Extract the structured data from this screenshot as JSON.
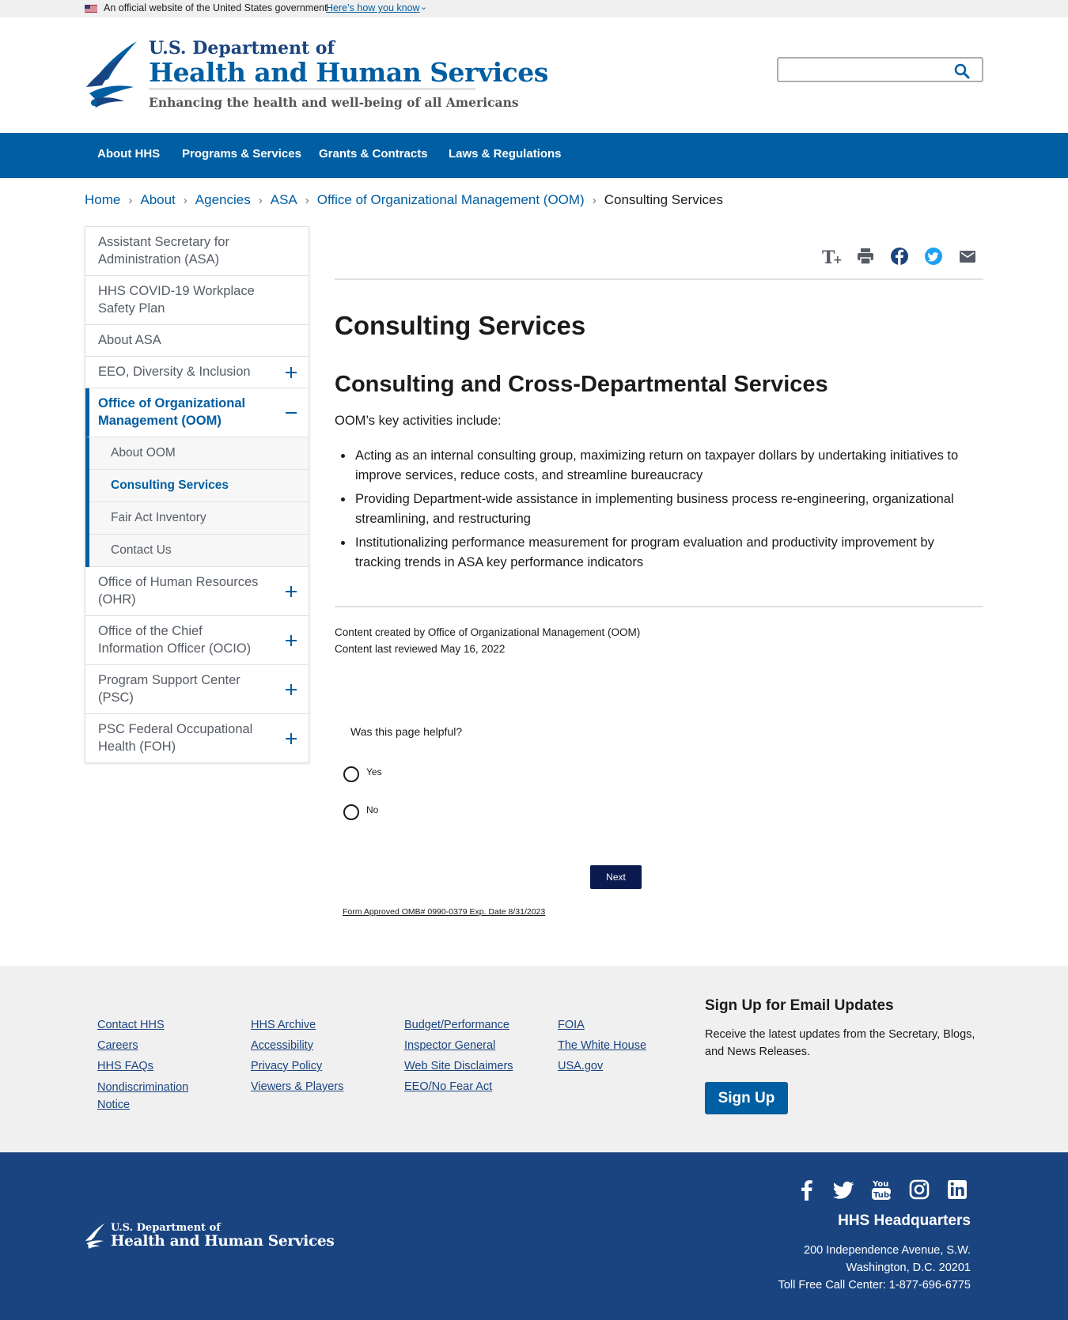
{
  "gov_banner": {
    "official_text": "An official website of the United States government",
    "how_you_know": "Here’s how you know"
  },
  "header": {
    "dept_line": "U.S. Department of",
    "agency_name": "Health and Human Services",
    "tagline": "Enhancing the health and well-being of all Americans",
    "search_value": ""
  },
  "nav": {
    "items": [
      "About HHS",
      "Programs & Services",
      "Grants & Contracts",
      "Laws & Regulations"
    ]
  },
  "breadcrumb": {
    "items": [
      "Home",
      "About",
      "Agencies",
      "ASA",
      "Office of Organizational Management (OOM)"
    ],
    "current": "Consulting Services"
  },
  "sidenav": {
    "items": [
      {
        "label": "Assistant Secretary for Administration (ASA)"
      },
      {
        "label": "HHS COVID-19 Workplace Safety Plan"
      },
      {
        "label": "About ASA"
      },
      {
        "label": "EEO, Diversity & Inclusion"
      },
      {
        "label": "Office of Organizational Management (OOM)"
      },
      {
        "label": "Office of Human Resources (OHR)"
      },
      {
        "label": "Office of the Chief Information Officer (OCIO)"
      },
      {
        "label": "Program Support Center (PSC)"
      },
      {
        "label": "PSC Federal Occupational Health (FOH)"
      }
    ],
    "sub_items": [
      {
        "label": "About OOM"
      },
      {
        "label": "Consulting Services"
      },
      {
        "label": "Fair Act Inventory"
      },
      {
        "label": "Contact Us"
      }
    ]
  },
  "main": {
    "page_title": "Consulting Services",
    "section_title": "Consulting and Cross-Departmental Services",
    "intro": "OOM’s key activities include:",
    "activities": [
      "Acting as an internal consulting group, maximizing return on taxpayer dollars by undertaking initiatives to improve services, reduce costs, and streamline bureaucracy",
      "Providing Department-wide assistance in implementing business process re-engineering, organizational streamlining, and restructuring",
      "Institutionalizing performance measurement for program evaluation and productivity improvement by tracking trends in ASA key performance indicators"
    ],
    "created_by": "Content created by Office of Organizational Management (OOM)",
    "reviewed": "Content last reviewed May 16, 2022"
  },
  "survey": {
    "question": "Was this page helpful?",
    "option_yes": "Yes",
    "option_no": "No",
    "next_label": "Next",
    "omb_text": "Form Approved OMB# 0990-0379 Exp. Date 8/31/2023"
  },
  "footer": {
    "col1": [
      "Contact HHS",
      "Careers",
      "HHS FAQs",
      "Nondiscrimination Notice"
    ],
    "col2": [
      "HHS Archive",
      "Accessibility",
      "Privacy Policy",
      "Viewers & Players"
    ],
    "col3": [
      "Budget/Performance",
      "Inspector General",
      "Web Site Disclaimers",
      "EEO/No Fear Act"
    ],
    "col4": [
      "FOIA",
      "The White House",
      "USA.gov"
    ],
    "signup_title": "Sign Up for Email Updates",
    "signup_text": "Receive the latest updates from the Secretary, Blogs, and News Releases.",
    "signup_button": "Sign Up",
    "hq_title": "HHS Headquarters",
    "hq_address_1": "200 Independence Avenue, S.W.",
    "hq_address_2": "Washington, D.C. 20201",
    "hq_phone": "Toll Free Call Center: 1-877-696-6775",
    "logo_dept": "U.S. Department of",
    "logo_agency": "Health and Human Services"
  },
  "colors": {
    "primary_blue": "#005ea2",
    "dark_blue": "#1a4480",
    "survey_button": "#0b1a4f"
  },
  "icons": {
    "share": [
      "text-size-icon",
      "print-icon",
      "facebook-icon",
      "twitter-icon",
      "email-icon"
    ],
    "social": [
      "facebook-icon",
      "twitter-icon",
      "youtube-icon",
      "instagram-icon",
      "linkedin-icon"
    ]
  }
}
